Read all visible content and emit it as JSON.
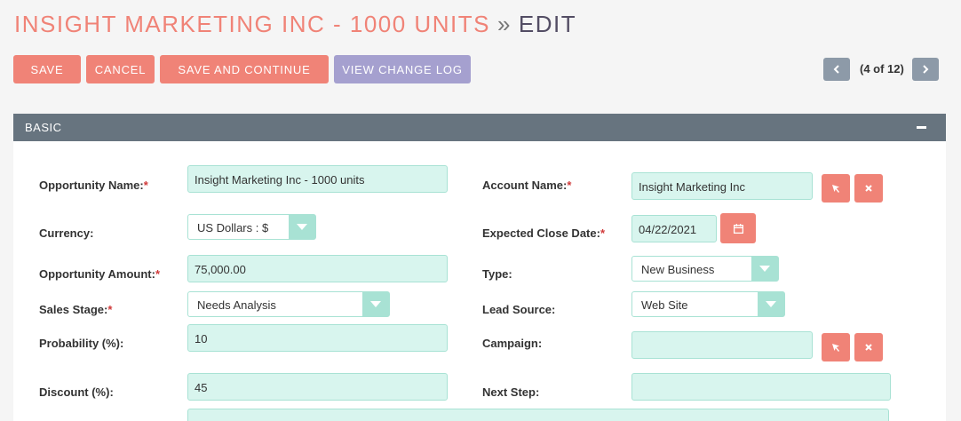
{
  "header": {
    "record_title": "INSIGHT MARKETING INC - 1000 UNITS",
    "separator": "»",
    "action": "EDIT"
  },
  "toolbar": {
    "save_label": "SAVE",
    "cancel_label": "CANCEL",
    "save_continue_label": "SAVE AND CONTINUE",
    "change_log_label": "VIEW CHANGE LOG"
  },
  "pager": {
    "text": "(4 of 12)"
  },
  "panel": {
    "title": "BASIC"
  },
  "form": {
    "opportunity_name": {
      "label": "Opportunity Name:",
      "required": "*",
      "value": "Insight Marketing Inc - 1000 units"
    },
    "account_name": {
      "label": "Account Name:",
      "required": "*",
      "value": "Insight Marketing Inc"
    },
    "currency": {
      "label": "Currency:",
      "value": "US Dollars : $"
    },
    "expected_close_date": {
      "label": "Expected Close Date:",
      "required": "*",
      "value": "04/22/2021"
    },
    "opportunity_amount": {
      "label": "Opportunity Amount:",
      "required": "*",
      "value": "75,000.00"
    },
    "type": {
      "label": "Type:",
      "value": "New Business"
    },
    "sales_stage": {
      "label": "Sales Stage:",
      "required": "*",
      "value": "Needs Analysis"
    },
    "lead_source": {
      "label": "Lead Source:",
      "value": "Web Site"
    },
    "probability": {
      "label": "Probability (%):",
      "value": "10"
    },
    "campaign": {
      "label": "Campaign:",
      "value": ""
    },
    "discount": {
      "label": "Discount (%):",
      "value": "45"
    },
    "next_step": {
      "label": "Next Step:",
      "value": ""
    }
  },
  "colors": {
    "accent_red": "#f08377",
    "accent_purple": "#a5a0cf",
    "panel_header": "#67747f",
    "input_bg": "#d8f5ee"
  }
}
